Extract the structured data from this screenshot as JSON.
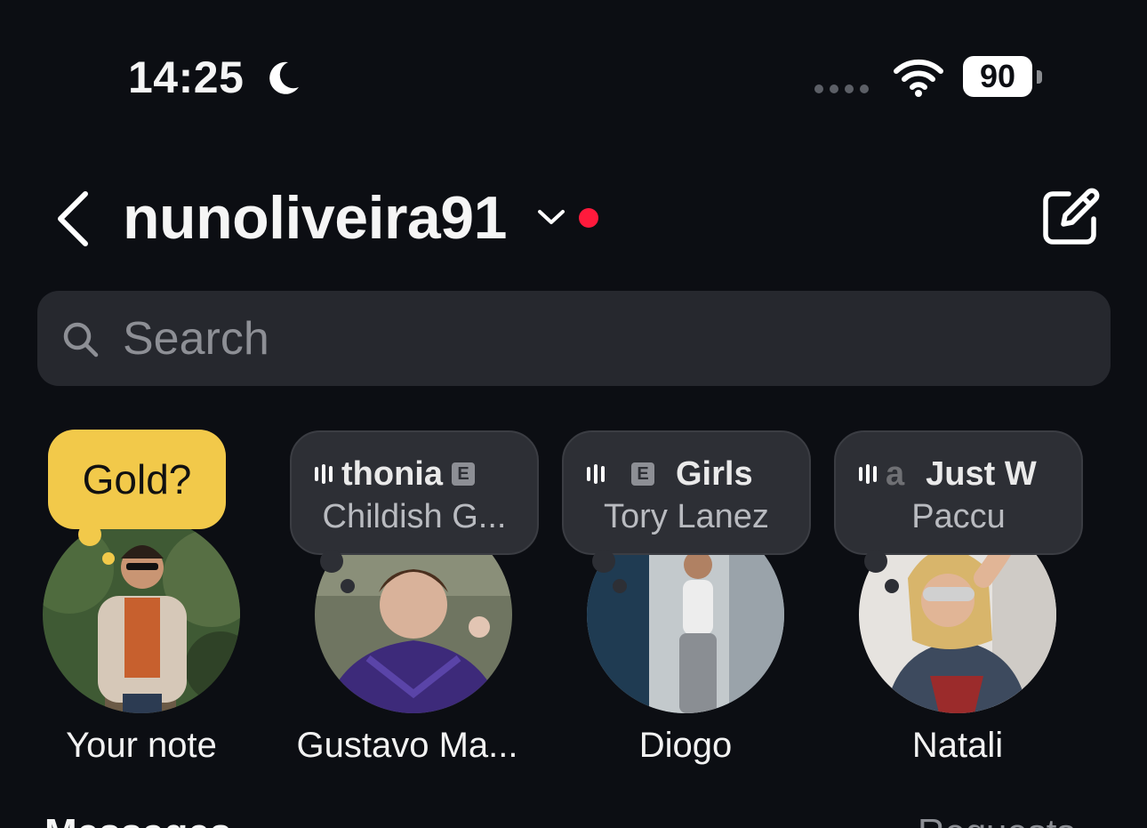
{
  "status_bar": {
    "time": "14:25",
    "battery": "90"
  },
  "header": {
    "account_name": "nunoliveira91"
  },
  "search": {
    "placeholder": "Search"
  },
  "notes": [
    {
      "name": "Your note",
      "note_text": "Gold?"
    },
    {
      "name": "Gustavo Ma...",
      "song": "thonia",
      "artist": "Childish G..."
    },
    {
      "name": "Diogo",
      "song": "Girls",
      "artist": "Tory Lanez"
    },
    {
      "name": "Natali",
      "song": "Just W",
      "artist": "Paccu"
    }
  ],
  "sections": {
    "messages": "Messages",
    "requests": "Requests"
  },
  "colors": {
    "background": "#0c0e13",
    "note_yellow": "#f2c94a",
    "online_dot": "#ff1a3c",
    "bubble": "#2d2f35"
  }
}
